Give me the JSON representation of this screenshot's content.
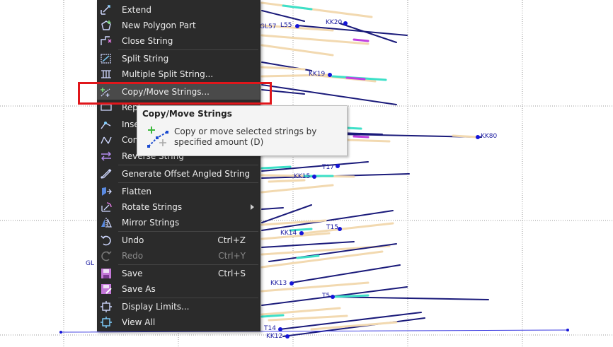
{
  "canvas": {
    "labels": [
      {
        "id": "kk20",
        "text": "KK20"
      },
      {
        "id": "gl57",
        "text": "GL57"
      },
      {
        "id": "l55",
        "text": "L55"
      },
      {
        "id": "kk19",
        "text": "KK19"
      },
      {
        "id": "kk80",
        "text": "KK80"
      },
      {
        "id": "t17",
        "text": "T17"
      },
      {
        "id": "kk15",
        "text": "KK15"
      },
      {
        "id": "kk14",
        "text": "KK14"
      },
      {
        "id": "t15",
        "text": "T15"
      },
      {
        "id": "gl",
        "text": "GL"
      },
      {
        "id": "kk13",
        "text": "KK13"
      },
      {
        "id": "t5",
        "text": "T5"
      },
      {
        "id": "t14",
        "text": "T14"
      },
      {
        "id": "kk12",
        "text": "KK12"
      }
    ]
  },
  "menu": {
    "items": [
      {
        "label": "Extend",
        "icon": "extend-icon"
      },
      {
        "label": "New Polygon Part",
        "icon": "polygon-part-icon"
      },
      {
        "label": "Close String",
        "icon": "close-string-icon"
      },
      {
        "label": "Split String",
        "icon": "split-string-icon"
      },
      {
        "label": "Multiple Split String...",
        "icon": "multi-split-icon"
      },
      {
        "label": "Copy/Move Strings...",
        "icon": "copy-move-icon"
      },
      {
        "label": "Repl",
        "icon": "replace-icon"
      },
      {
        "label": "Inser",
        "icon": "insert-icon"
      },
      {
        "label": "Conn",
        "icon": "connect-icon"
      },
      {
        "label": "Reverse String",
        "icon": "reverse-icon"
      },
      {
        "label": "Generate Offset Angled String",
        "icon": "offset-angled-icon"
      },
      {
        "label": "Flatten",
        "icon": "flatten-icon"
      },
      {
        "label": "Rotate Strings",
        "icon": "rotate-icon"
      },
      {
        "label": "Mirror Strings",
        "icon": "mirror-icon"
      },
      {
        "label": "Undo",
        "shortcut": "Ctrl+Z",
        "icon": "undo-icon"
      },
      {
        "label": "Redo",
        "shortcut": "Ctrl+Y",
        "icon": "redo-icon"
      },
      {
        "label": "Save",
        "shortcut": "Ctrl+S",
        "icon": "save-icon"
      },
      {
        "label": "Save As",
        "icon": "save-as-icon"
      },
      {
        "label": "Display Limits...",
        "icon": "display-limits-icon"
      },
      {
        "label": "View All",
        "icon": "view-all-icon"
      }
    ]
  },
  "tooltip": {
    "title": "Copy/Move Strings",
    "description": "Copy or move selected strings by specified amount (D)",
    "icon": "copy-move-icon"
  },
  "colors": {
    "menu_bg": "#2b2b2b",
    "highlight_box": "#e0161b",
    "string_dark": "#1a1a7a",
    "string_tan": "#f2d9b0",
    "marker": "#1515d8"
  }
}
